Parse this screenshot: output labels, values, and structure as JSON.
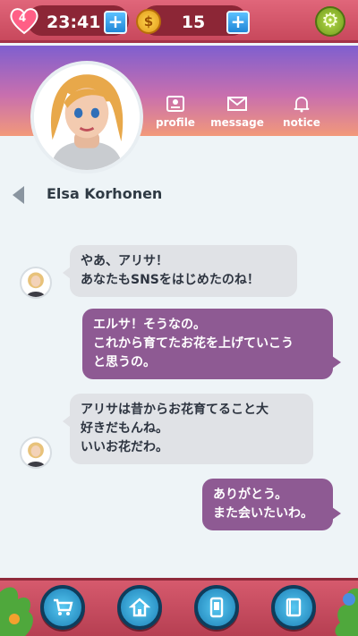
{
  "status_bar": {
    "lives": "4",
    "timer": "23:41",
    "coin_symbol": "$",
    "coins": "15",
    "plus_label": "+"
  },
  "profile_header": {
    "icons": [
      {
        "label": "profile",
        "icon": "id-card-icon"
      },
      {
        "label": "message",
        "icon": "envelope-icon"
      },
      {
        "label": "notice",
        "icon": "bell-icon"
      }
    ]
  },
  "chat": {
    "contact_name": "Elsa Korhonen",
    "messages": [
      {
        "from": "contact",
        "text": "やあ、アリサ！\nあなたもSNSをはじめたのね！"
      },
      {
        "from": "me",
        "text": "エルサ！そうなの。\nこれから育てたお花を上げていこう\nと思うの。"
      },
      {
        "from": "contact",
        "text": "アリサは昔からお花育てること大\n好きだもんね。\nいいお花だわ。"
      },
      {
        "from": "me",
        "text": "ありがとう。\nまた会いたいわ。"
      }
    ]
  },
  "bottom_nav": {
    "items": [
      {
        "icon": "cart-icon"
      },
      {
        "icon": "house-icon"
      },
      {
        "icon": "phone-icon"
      },
      {
        "icon": "book-icon"
      }
    ]
  },
  "colors": {
    "status_bar": "#d65a6d",
    "incoming_bubble": "#e0e2e6",
    "outgoing_bubble": "#8e5a93",
    "nav_button": "#2d9bd3"
  }
}
